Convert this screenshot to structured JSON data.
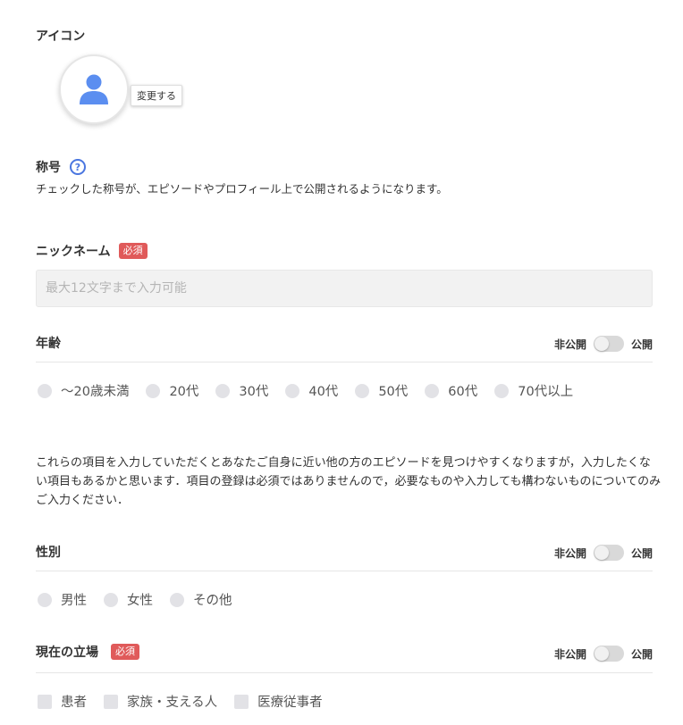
{
  "icon_section": {
    "label": "アイコン",
    "change_label": "変更する"
  },
  "title_section": {
    "label": "称号",
    "help_glyph": "?",
    "description": "チェックした称号が、エピソードやプロフィール上で公開されるようになります。"
  },
  "nickname": {
    "label": "ニックネーム",
    "required": "必須",
    "placeholder": "最大12文字まで入力可能",
    "value": ""
  },
  "age": {
    "label": "年齢",
    "private_label": "非公開",
    "public_label": "公開",
    "public": false,
    "options": [
      "〜20歳未満",
      "20代",
      "30代",
      "40代",
      "50代",
      "60代",
      "70代以上"
    ]
  },
  "info_paragraph": "これらの項目を入力していただくとあなたご自身に近い他の方のエピソードを見つけやすくなりますが，入力したくない項目もあるかと思います．項目の登録は必須ではありませんので，必要なものや入力しても構わないものについてのみご入力ください．",
  "gender": {
    "label": "性別",
    "private_label": "非公開",
    "public_label": "公開",
    "public": false,
    "options": [
      "男性",
      "女性",
      "その他"
    ]
  },
  "position": {
    "label": "現在の立場",
    "required": "必須",
    "private_label": "非公開",
    "public_label": "公開",
    "public": false,
    "options": [
      "患者",
      "家族・支える人",
      "医療従事者"
    ]
  },
  "colors": {
    "accent": "#4a76e0",
    "avatar": "#5b8ef0",
    "required_badge": "#e05a5a"
  }
}
